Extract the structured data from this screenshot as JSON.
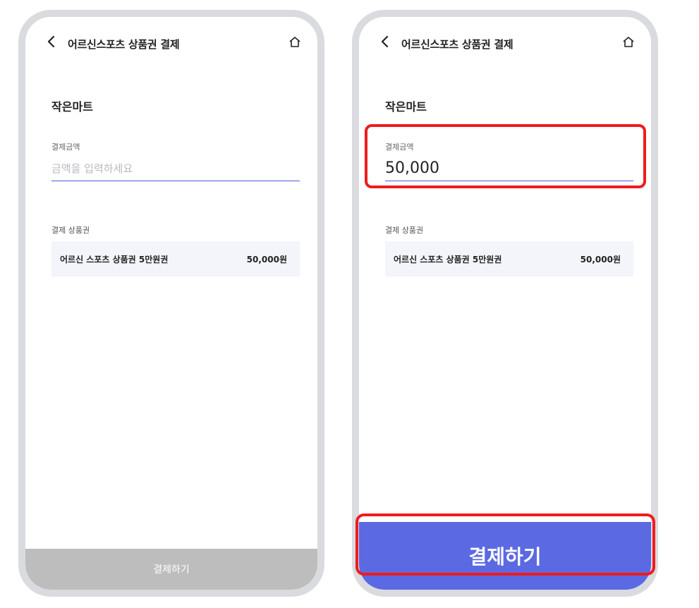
{
  "screens": [
    {
      "title": "어르신스포츠 상품권 결제",
      "store_name": "작은마트",
      "amount_label": "결제금액",
      "amount_value": "",
      "amount_placeholder": "금액을 입력하세요",
      "voucher_label": "결제 상품권",
      "voucher_name": "어르신 스포츠 상품권 5만원권",
      "voucher_price": "50,000원",
      "pay_button_label": "결제하기",
      "pay_button_enabled": false
    },
    {
      "title": "어르신스포츠 상품권 결제",
      "store_name": "작은마트",
      "amount_label": "결제금액",
      "amount_value": "50,000",
      "voucher_label": "결제 상품권",
      "voucher_name": "어르신 스포츠 상품권 5만원권",
      "voucher_price": "50,000원",
      "pay_button_label": "결제하기",
      "pay_button_enabled": true
    }
  ],
  "icons": {
    "back": "chevron-left-icon",
    "home": "home-icon"
  },
  "colors": {
    "accent": "#5b69e3",
    "disabled": "#bdbdbd",
    "highlight": "#ef1c1c",
    "frame": "#d9dbde",
    "voucher_bg": "#f3f5fa"
  }
}
